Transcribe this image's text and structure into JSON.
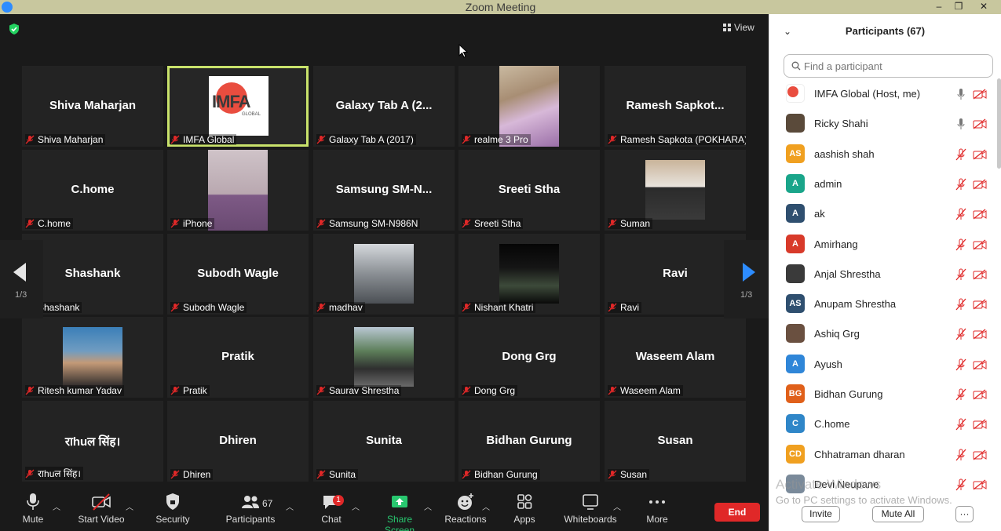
{
  "window": {
    "title": "Zoom Meeting",
    "minimize": "–",
    "restore": "❐",
    "close": "✕"
  },
  "view": {
    "label": "View"
  },
  "gallery": {
    "page": "1/3",
    "tiles": [
      {
        "big": "Shiva Maharjan",
        "label": "Shiva Maharjan"
      },
      {
        "big": "",
        "label": "IMFA Global",
        "logo": "IMFA",
        "logo_sub": "GLOBAL"
      },
      {
        "big": "Galaxy Tab A (2...",
        "label": "Galaxy Tab A (2017)"
      },
      {
        "big": "",
        "label": "realme 3 Pro"
      },
      {
        "big": "Ramesh  Sapkot...",
        "label": "Ramesh Sapkota (POKHARA)"
      },
      {
        "big": "C.home",
        "label": "C.home"
      },
      {
        "big": "",
        "label": "iPhone"
      },
      {
        "big": "Samsung  SM-N...",
        "label": "Samsung SM-N986N"
      },
      {
        "big": "Sreeti Stha",
        "label": "Sreeti Stha"
      },
      {
        "big": "",
        "label": "Suman"
      },
      {
        "big": "Shashank",
        "label": "Shashank"
      },
      {
        "big": "Subodh Wagle",
        "label": "Subodh Wagle"
      },
      {
        "big": "",
        "label": "madhav"
      },
      {
        "big": "",
        "label": "Nishant Khatri"
      },
      {
        "big": "Ravi",
        "label": "Ravi"
      },
      {
        "big": "",
        "label": "Ritesh kumar Yadav"
      },
      {
        "big": "Pratik",
        "label": "Pratik"
      },
      {
        "big": "",
        "label": "Saurav Shrestha"
      },
      {
        "big": "Dong Grg",
        "label": "Dong Grg"
      },
      {
        "big": "Waseem Alam",
        "label": "Waseem Alam"
      },
      {
        "big": "राhuल सिंह।",
        "label": "राhuल सिंह।"
      },
      {
        "big": "Dhiren",
        "label": "Dhiren"
      },
      {
        "big": "Sunita",
        "label": "Sunita"
      },
      {
        "big": "Bidhan Gurung",
        "label": "Bidhan Gurung"
      },
      {
        "big": "Susan",
        "label": "Susan"
      }
    ]
  },
  "toolbar": {
    "mute": "Mute",
    "start_video": "Start Video",
    "security": "Security",
    "participants": "Participants",
    "participants_count": "67",
    "chat": "Chat",
    "chat_badge": "1",
    "share_screen": "Share Screen",
    "reactions": "Reactions",
    "apps": "Apps",
    "whiteboards": "Whiteboards",
    "more": "More",
    "end": "End"
  },
  "panel": {
    "title": "Participants (67)",
    "search_placeholder": "Find a participant",
    "participants": [
      {
        "name": "IMFA Global (Host, me)",
        "initials": "",
        "color": "#ffffff",
        "mic": "on"
      },
      {
        "name": "Ricky Shahi",
        "initials": "",
        "color": "#5a4a3a",
        "mic": "on"
      },
      {
        "name": "aashish shah",
        "initials": "AS",
        "color": "#f0a020",
        "mic": "muted"
      },
      {
        "name": "admin",
        "initials": "A",
        "color": "#1aa58a",
        "mic": "muted"
      },
      {
        "name": "ak",
        "initials": "A",
        "color": "#2f4f6f",
        "mic": "muted"
      },
      {
        "name": "Amirhang",
        "initials": "A",
        "color": "#d83a2a",
        "mic": "muted"
      },
      {
        "name": "Anjal Shrestha",
        "initials": "",
        "color": "#3a3a3a",
        "mic": "muted"
      },
      {
        "name": "Anupam Shrestha",
        "initials": "AS",
        "color": "#2f4f6f",
        "mic": "muted"
      },
      {
        "name": "Ashiq Grg",
        "initials": "",
        "color": "#6a5040",
        "mic": "muted"
      },
      {
        "name": "Ayush",
        "initials": "A",
        "color": "#2f86d8",
        "mic": "muted"
      },
      {
        "name": "Bidhan Gurung",
        "initials": "BG",
        "color": "#e0601a",
        "mic": "muted"
      },
      {
        "name": "C.home",
        "initials": "C",
        "color": "#2f86c8",
        "mic": "muted"
      },
      {
        "name": "Chhatraman dharan",
        "initials": "CD",
        "color": "#f0a020",
        "mic": "muted"
      },
      {
        "name": "Devi Neupane",
        "initials": "",
        "color": "#7a8a9a",
        "mic": "muted"
      }
    ],
    "watermark_title": "Activate Windows",
    "watermark_sub": "Go to PC settings to activate Windows.",
    "invite": "Invite",
    "mute_all": "Mute All",
    "more": "···"
  }
}
